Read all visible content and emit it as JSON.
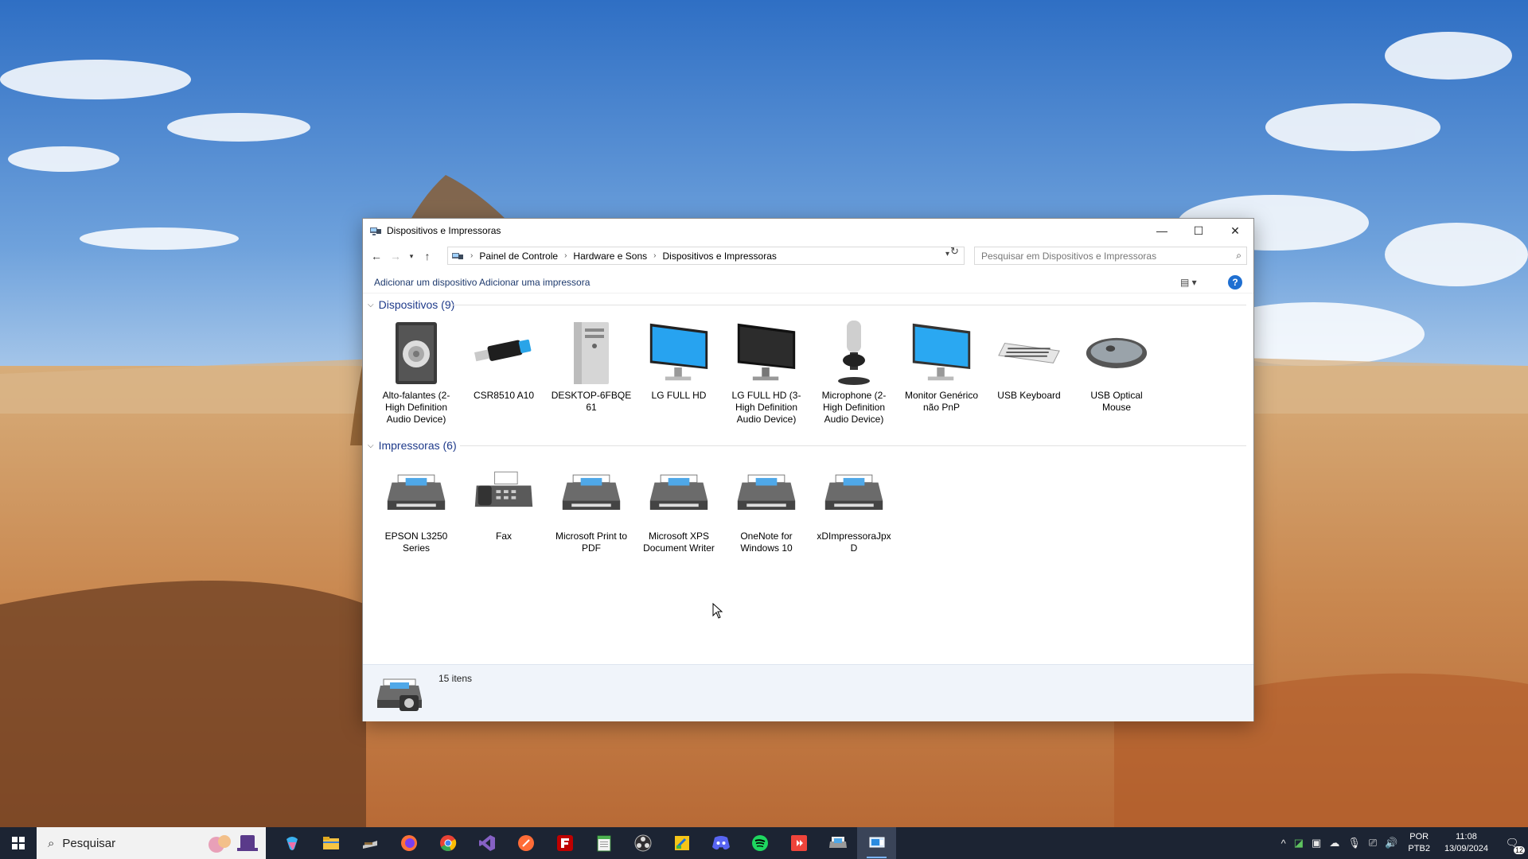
{
  "window": {
    "title": "Dispositivos e Impressoras",
    "minimize": "—",
    "maximize": "☐",
    "close": "✕"
  },
  "address": {
    "breadcrumbs": [
      "Painel de Controle",
      "Hardware e Sons",
      "Dispositivos e Impressoras"
    ],
    "search_placeholder": "Pesquisar em Dispositivos e Impressoras"
  },
  "commands": {
    "add_device": "Adicionar um dispositivo",
    "add_printer": "Adicionar uma impressora",
    "help": "?"
  },
  "groups": {
    "devices": {
      "header": "Dispositivos (9)",
      "items": [
        {
          "label": "Alto-falantes (2- High Definition Audio Device)",
          "icon": "speaker-icon"
        },
        {
          "label": "CSR8510 A10",
          "icon": "usb-dongle-icon"
        },
        {
          "label": "DESKTOP-6FBQE 61",
          "icon": "computer-tower-icon"
        },
        {
          "label": "LG FULL HD",
          "icon": "monitor-icon"
        },
        {
          "label": "LG FULL HD (3- High Definition Audio Device)",
          "icon": "monitor-dark-icon"
        },
        {
          "label": "Microphone (2- High Definition Audio Device)",
          "icon": "microphone-icon"
        },
        {
          "label": "Monitor Genérico não PnP",
          "icon": "monitor-icon"
        },
        {
          "label": "USB Keyboard",
          "icon": "keyboard-icon"
        },
        {
          "label": "USB Optical Mouse",
          "icon": "mouse-icon"
        }
      ]
    },
    "printers": {
      "header": "Impressoras (6)",
      "items": [
        {
          "label": "EPSON L3250 Series",
          "icon": "printer-icon"
        },
        {
          "label": "Fax",
          "icon": "fax-icon"
        },
        {
          "label": "Microsoft Print to PDF",
          "icon": "printer-icon"
        },
        {
          "label": "Microsoft XPS Document Writer",
          "icon": "printer-icon"
        },
        {
          "label": "OneNote for Windows 10",
          "icon": "printer-icon"
        },
        {
          "label": "xDImpressoraJpx D",
          "icon": "printer-icon"
        }
      ]
    }
  },
  "details": {
    "count": "15 itens"
  },
  "taskbar": {
    "search_label": "Pesquisar",
    "language": [
      "POR",
      "PTB2"
    ],
    "time": "11:08",
    "date": "13/09/2024",
    "notifications": "12"
  },
  "colors": {
    "accent": "#1e3a8a",
    "taskbar": "#1c2433"
  }
}
